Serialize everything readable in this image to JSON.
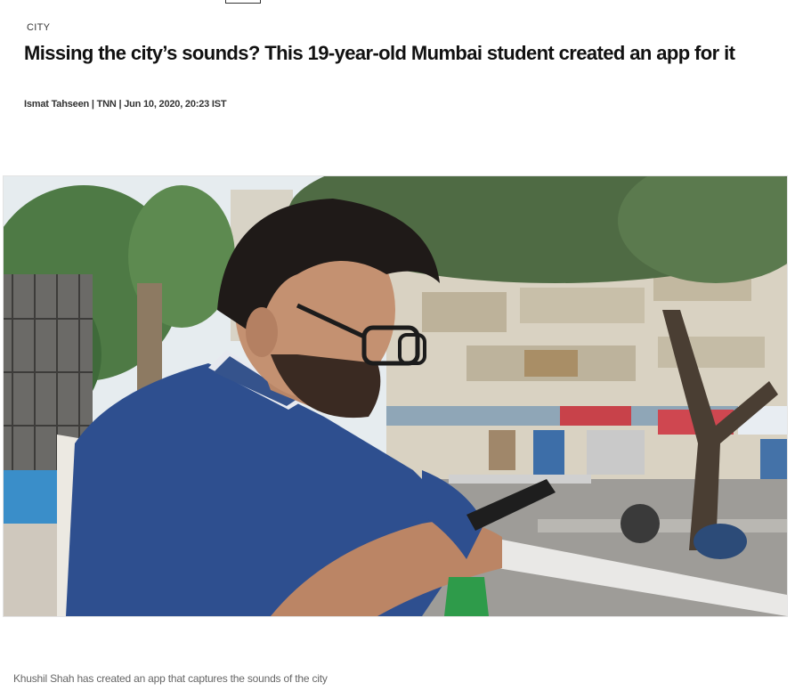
{
  "article": {
    "section": "CITY",
    "headline": "Missing the city’s sounds? This 19-year-old Mumbai student created an app for it",
    "byline": "Ismat Tahseen | TNN | Jun 10, 2020, 20:23 IST"
  },
  "photo": {
    "caption": "Khushil Shah has created an app that captures the sounds of the city"
  },
  "colors": {
    "headline": "#111111",
    "caption": "#666666",
    "shirt": "#2e4f8f"
  }
}
